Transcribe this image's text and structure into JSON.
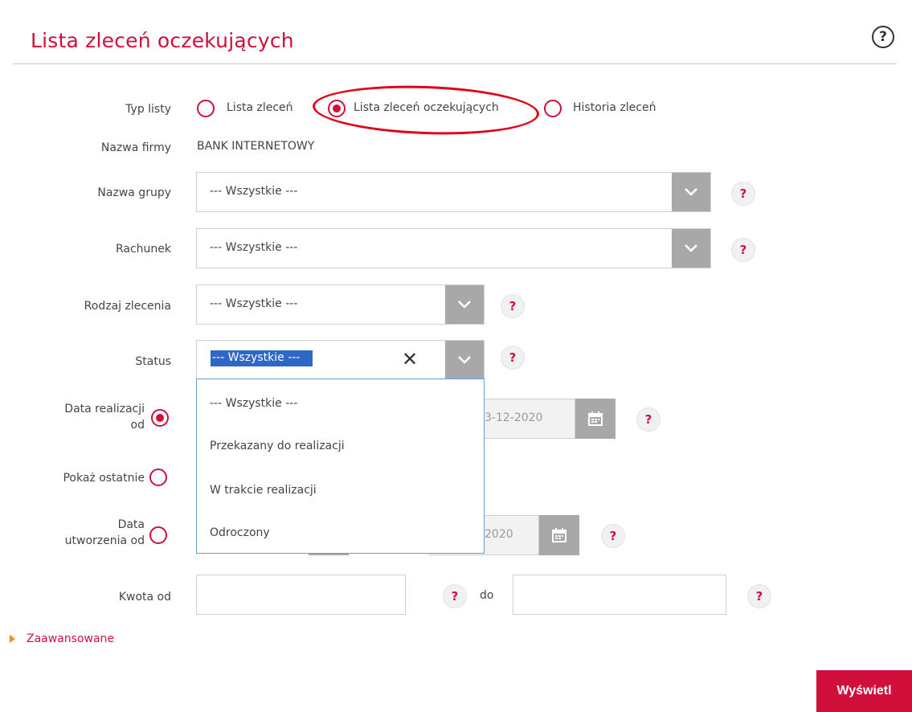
{
  "title": "Lista zleceń oczekujących",
  "labels": {
    "typ_listy": "Typ listy",
    "nazwa_firmy": "Nazwa firmy",
    "nazwa_grupy": "Nazwa grupy",
    "rachunek": "Rachunek",
    "rodzaj_zlecenia": "Rodzaj zlecenia",
    "status": "Status",
    "data_realizacji_1": "Data realizacji",
    "data_realizacji_2": "od",
    "pokaz_ostatnie": "Pokaż ostatnie",
    "data_utworzenia_1": "Data",
    "data_utworzenia_2": "utworzenia od",
    "kwota_od": "Kwota od",
    "do": "do"
  },
  "radio_options": {
    "lista_zlecen": "Lista zleceń",
    "lista_oczekujacych": "Lista zleceń oczekujących",
    "historia": "Historia zleceń"
  },
  "company_name": "BANK INTERNETOWY",
  "selects": {
    "grupa": "--- Wszystkie ---",
    "rachunek": "--- Wszystkie ---",
    "rodzaj": "--- Wszystkie ---",
    "status": "--- Wszystkie ---"
  },
  "status_options": [
    "--- Wszystkie ---",
    "Przekazany do realizacji",
    "W trakcie realizacji",
    "Odroczony"
  ],
  "dates": {
    "realizacji_do_partial": "3-12-2020",
    "utworzenia_do_partial": "2020"
  },
  "advanced_link": "Zaawansowane",
  "submit_label": "Wyświetl",
  "help_glyph": "?"
}
